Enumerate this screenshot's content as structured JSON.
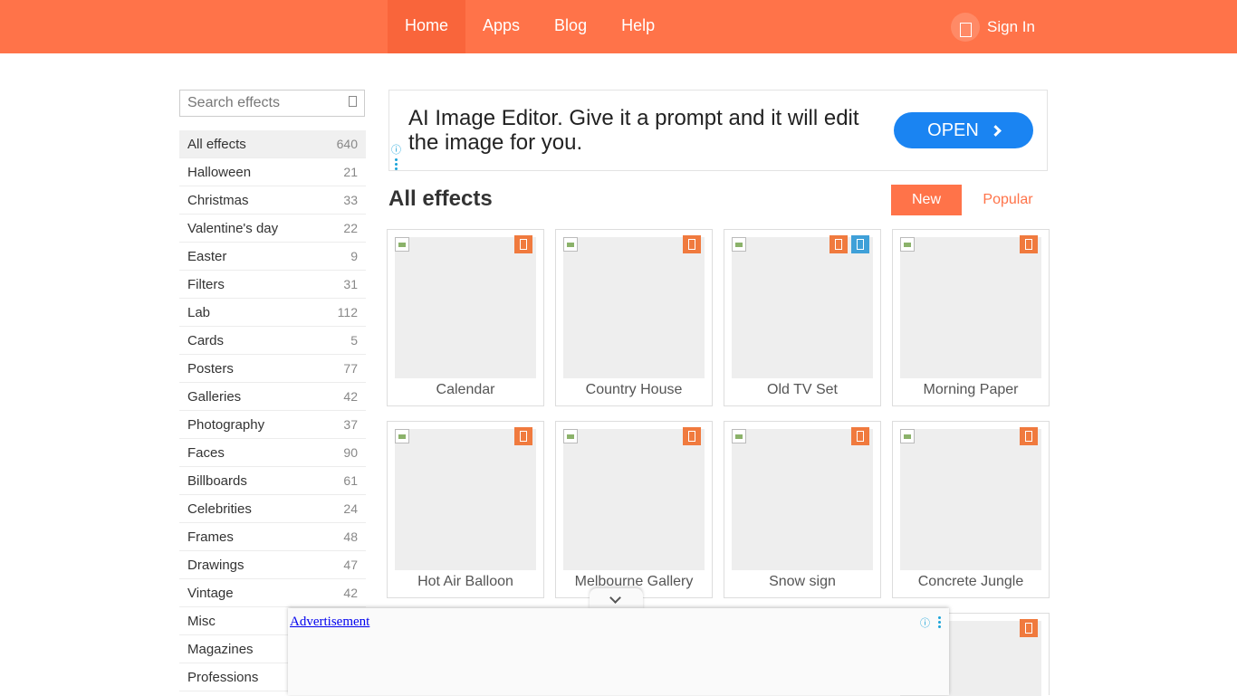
{
  "nav": {
    "items": [
      {
        "label": "Home",
        "active": true
      },
      {
        "label": "Apps",
        "active": false
      },
      {
        "label": "Blog",
        "active": false
      },
      {
        "label": "Help",
        "active": false
      }
    ],
    "signin_label": "Sign In"
  },
  "search": {
    "placeholder": "Search effects",
    "value": ""
  },
  "categories": [
    {
      "label": "All effects",
      "count": "640",
      "active": true
    },
    {
      "label": "Halloween",
      "count": "21"
    },
    {
      "label": "Christmas",
      "count": "33"
    },
    {
      "label": "Valentine's day",
      "count": "22"
    },
    {
      "label": "Easter",
      "count": "9"
    },
    {
      "label": "Filters",
      "count": "31"
    },
    {
      "label": "Lab",
      "count": "112"
    },
    {
      "label": "Cards",
      "count": "5"
    },
    {
      "label": "Posters",
      "count": "77"
    },
    {
      "label": "Galleries",
      "count": "42"
    },
    {
      "label": "Photography",
      "count": "37"
    },
    {
      "label": "Faces",
      "count": "90"
    },
    {
      "label": "Billboards",
      "count": "61"
    },
    {
      "label": "Celebrities",
      "count": "24"
    },
    {
      "label": "Frames",
      "count": "48"
    },
    {
      "label": "Drawings",
      "count": "47"
    },
    {
      "label": "Vintage",
      "count": "42"
    },
    {
      "label": "Misc",
      "count": ""
    },
    {
      "label": "Magazines",
      "count": ""
    },
    {
      "label": "Professions",
      "count": ""
    }
  ],
  "ad_top": {
    "text": "AI Image Editor. Give it a prompt and it will edit the image for you.",
    "button_label": "OPEN",
    "info_icon": "ⓘ"
  },
  "main": {
    "title": "All effects",
    "sort_new": "New",
    "sort_popular": "Popular"
  },
  "effects": [
    {
      "name": "Calendar"
    },
    {
      "name": "Country House"
    },
    {
      "name": "Old TV Set"
    },
    {
      "name": "Morning Paper"
    },
    {
      "name": "Hot Air Balloon"
    },
    {
      "name": "Melbourne Gallery"
    },
    {
      "name": "Snow sign"
    },
    {
      "name": "Concrete Jungle"
    }
  ],
  "ad_bottom": {
    "link_text": "Advertisement",
    "info_icon": "ⓘ"
  },
  "colors": {
    "brand": "#ff7349",
    "nav_active": "#f9653b",
    "ad_button": "#1a84f2",
    "badge": "#f07a3e",
    "badge_blue": "#3fa0d8"
  }
}
